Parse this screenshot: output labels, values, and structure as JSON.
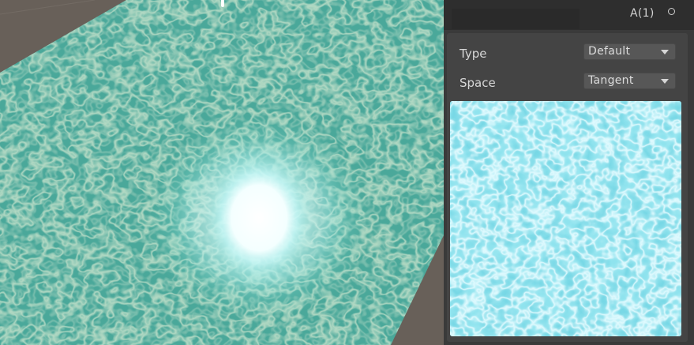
{
  "node": {
    "title": "A(1)",
    "name_value": ""
  },
  "properties": [
    {
      "label": "Type",
      "value": "Default"
    },
    {
      "label": "Space",
      "value": "Tangent"
    }
  ],
  "icons": {
    "port": "output-port-circle-icon",
    "dropdown": "chevron-down-icon"
  },
  "colors": {
    "water_surface": "#4aa89a",
    "water_highlight": "#a6d3be",
    "preview_base": "#8fe3ee",
    "preview_highlight": "#e2fbff",
    "panel_background": "#3a3a3a",
    "glow": "#ffffff"
  }
}
